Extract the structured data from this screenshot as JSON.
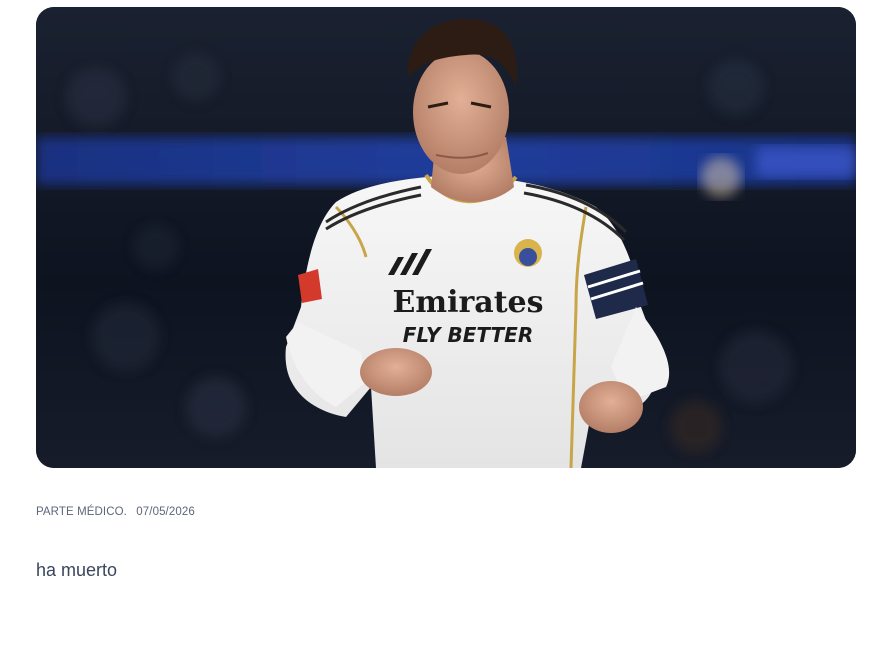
{
  "article": {
    "image_alt": "Jugador del Real Madrid con la camiseta blanca",
    "category": "PARTE MÉDICO.",
    "date": "07/05/2026",
    "body": "ha muerto"
  },
  "jersey": {
    "sponsor": "Emirates",
    "slogan": "FLY BETTER"
  },
  "colors": {
    "kit_white": "#f2f2f2",
    "gold_trim": "#c9a54a",
    "stadium_blue": "#1e3c9c",
    "meta_text": "#5d6678",
    "body_text": "#3a465c"
  }
}
